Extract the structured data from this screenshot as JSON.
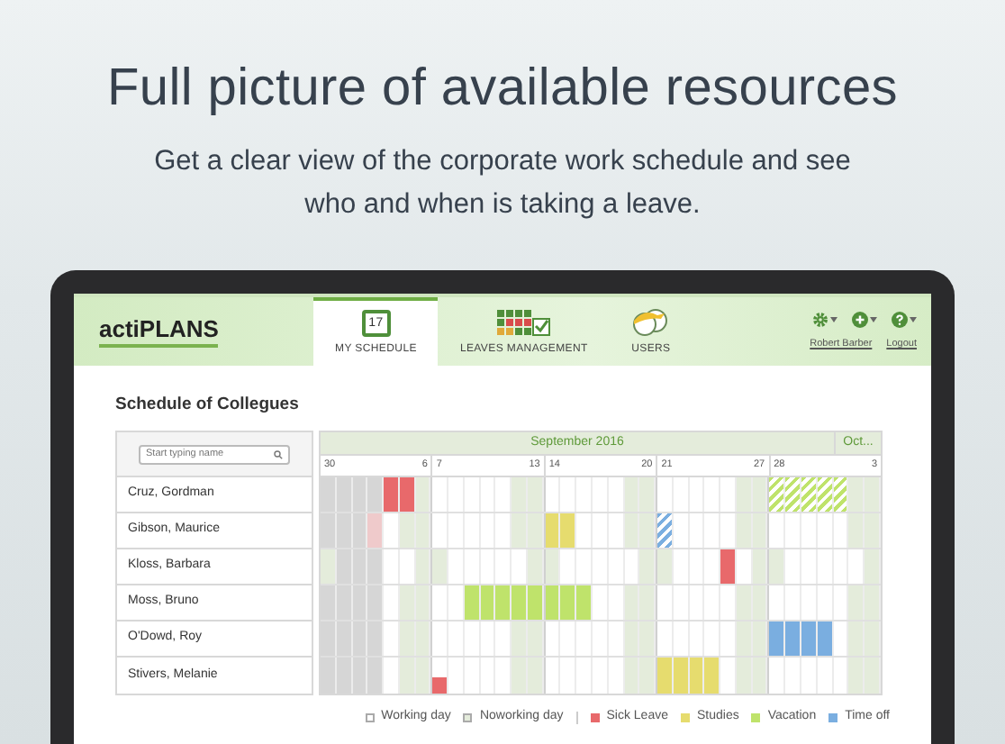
{
  "hero": {
    "title": "Full picture of available resources",
    "subtitle": "Get a clear view of the corporate work schedule and see who and when is taking a leave."
  },
  "app": {
    "logo": "actiPLANS",
    "tabs": [
      {
        "label": "MY SCHEDULE",
        "kind": "calendar",
        "badge": "17",
        "selected": true
      },
      {
        "label": "LEAVES MANAGEMENT",
        "kind": "grid",
        "selected": false
      },
      {
        "label": "USERS",
        "kind": "users",
        "selected": false
      }
    ],
    "tools": [
      {
        "kind": "gear"
      },
      {
        "kind": "plus"
      },
      {
        "kind": "help"
      }
    ],
    "user": "Robert Barber",
    "logout": "Logout"
  },
  "schedule": {
    "title": "Schedule of Collegues",
    "search": {
      "placeholder": "Start typing name"
    },
    "months": [
      "September 2016",
      "Oct..."
    ],
    "weeks": [
      {
        "start": "30",
        "end": "6"
      },
      {
        "start": "7",
        "end": "13"
      },
      {
        "start": "14",
        "end": "20"
      },
      {
        "start": "21",
        "end": "27"
      },
      {
        "start": "28",
        "end": "3"
      }
    ],
    "rows": [
      {
        "name": "Cruz, Gordman",
        "cells": [
          {
            "kind": "past"
          },
          {
            "kind": "past"
          },
          {
            "kind": "past"
          },
          {
            "kind": "past"
          },
          {
            "kind": "sick"
          },
          {
            "kind": "sick"
          },
          {
            "kind": "off"
          },
          {
            "kind": "work"
          },
          {
            "kind": "work"
          },
          {
            "kind": "work"
          },
          {
            "kind": "work"
          },
          {
            "kind": "work"
          },
          {
            "kind": "off"
          },
          {
            "kind": "off"
          },
          {
            "kind": "work"
          },
          {
            "kind": "work"
          },
          {
            "kind": "work"
          },
          {
            "kind": "work"
          },
          {
            "kind": "work"
          },
          {
            "kind": "off"
          },
          {
            "kind": "off"
          },
          {
            "kind": "work"
          },
          {
            "kind": "work"
          },
          {
            "kind": "work"
          },
          {
            "kind": "work"
          },
          {
            "kind": "work"
          },
          {
            "kind": "off"
          },
          {
            "kind": "off"
          },
          {
            "kind": "vacation-req"
          },
          {
            "kind": "vacation-req"
          },
          {
            "kind": "vacation-req"
          },
          {
            "kind": "vacation-req"
          },
          {
            "kind": "vacation-req"
          },
          {
            "kind": "off"
          },
          {
            "kind": "off"
          }
        ]
      },
      {
        "name": "Gibson, Maurice",
        "cells": [
          {
            "kind": "past"
          },
          {
            "kind": "past"
          },
          {
            "kind": "past"
          },
          {
            "kind": "sick-light"
          },
          {
            "kind": "work"
          },
          {
            "kind": "off"
          },
          {
            "kind": "off"
          },
          {
            "kind": "work"
          },
          {
            "kind": "work"
          },
          {
            "kind": "work"
          },
          {
            "kind": "work"
          },
          {
            "kind": "work"
          },
          {
            "kind": "off"
          },
          {
            "kind": "off"
          },
          {
            "kind": "study"
          },
          {
            "kind": "study"
          },
          {
            "kind": "work"
          },
          {
            "kind": "work"
          },
          {
            "kind": "work"
          },
          {
            "kind": "off"
          },
          {
            "kind": "off"
          },
          {
            "kind": "timeoff-req"
          },
          {
            "kind": "work"
          },
          {
            "kind": "work"
          },
          {
            "kind": "work"
          },
          {
            "kind": "work"
          },
          {
            "kind": "off"
          },
          {
            "kind": "off"
          },
          {
            "kind": "work"
          },
          {
            "kind": "work"
          },
          {
            "kind": "work"
          },
          {
            "kind": "work"
          },
          {
            "kind": "work"
          },
          {
            "kind": "off"
          },
          {
            "kind": "off"
          }
        ]
      },
      {
        "name": "Kloss, Barbara",
        "cells": [
          {
            "kind": "off"
          },
          {
            "kind": "past"
          },
          {
            "kind": "past"
          },
          {
            "kind": "past"
          },
          {
            "kind": "work"
          },
          {
            "kind": "work"
          },
          {
            "kind": "off"
          },
          {
            "kind": "off"
          },
          {
            "kind": "work"
          },
          {
            "kind": "work"
          },
          {
            "kind": "work"
          },
          {
            "kind": "work"
          },
          {
            "kind": "work"
          },
          {
            "kind": "off"
          },
          {
            "kind": "off"
          },
          {
            "kind": "work"
          },
          {
            "kind": "work"
          },
          {
            "kind": "work"
          },
          {
            "kind": "work"
          },
          {
            "kind": "work"
          },
          {
            "kind": "off"
          },
          {
            "kind": "off"
          },
          {
            "kind": "work"
          },
          {
            "kind": "work"
          },
          {
            "kind": "work"
          },
          {
            "kind": "sick"
          },
          {
            "kind": "work"
          },
          {
            "kind": "off"
          },
          {
            "kind": "off"
          },
          {
            "kind": "work"
          },
          {
            "kind": "work"
          },
          {
            "kind": "work"
          },
          {
            "kind": "work"
          },
          {
            "kind": "work"
          },
          {
            "kind": "off"
          }
        ]
      },
      {
        "name": "Moss, Bruno",
        "cells": [
          {
            "kind": "past"
          },
          {
            "kind": "past"
          },
          {
            "kind": "past"
          },
          {
            "kind": "past"
          },
          {
            "kind": "work"
          },
          {
            "kind": "off"
          },
          {
            "kind": "off"
          },
          {
            "kind": "work"
          },
          {
            "kind": "work"
          },
          {
            "kind": "vacation"
          },
          {
            "kind": "vacation"
          },
          {
            "kind": "vacation"
          },
          {
            "kind": "vacation"
          },
          {
            "kind": "vacation"
          },
          {
            "kind": "vacation"
          },
          {
            "kind": "vacation"
          },
          {
            "kind": "vacation"
          },
          {
            "kind": "work"
          },
          {
            "kind": "work"
          },
          {
            "kind": "off"
          },
          {
            "kind": "off"
          },
          {
            "kind": "work"
          },
          {
            "kind": "work"
          },
          {
            "kind": "work"
          },
          {
            "kind": "work"
          },
          {
            "kind": "work"
          },
          {
            "kind": "off"
          },
          {
            "kind": "off"
          },
          {
            "kind": "work"
          },
          {
            "kind": "work"
          },
          {
            "kind": "work"
          },
          {
            "kind": "work"
          },
          {
            "kind": "work"
          },
          {
            "kind": "off"
          },
          {
            "kind": "off"
          }
        ]
      },
      {
        "name": "O'Dowd, Roy",
        "cells": [
          {
            "kind": "past"
          },
          {
            "kind": "past"
          },
          {
            "kind": "past"
          },
          {
            "kind": "past"
          },
          {
            "kind": "work"
          },
          {
            "kind": "off"
          },
          {
            "kind": "off"
          },
          {
            "kind": "work"
          },
          {
            "kind": "work"
          },
          {
            "kind": "work"
          },
          {
            "kind": "work"
          },
          {
            "kind": "work"
          },
          {
            "kind": "off"
          },
          {
            "kind": "off"
          },
          {
            "kind": "work"
          },
          {
            "kind": "work"
          },
          {
            "kind": "work"
          },
          {
            "kind": "work"
          },
          {
            "kind": "work"
          },
          {
            "kind": "off"
          },
          {
            "kind": "off"
          },
          {
            "kind": "work"
          },
          {
            "kind": "work"
          },
          {
            "kind": "work"
          },
          {
            "kind": "work"
          },
          {
            "kind": "work"
          },
          {
            "kind": "off"
          },
          {
            "kind": "off"
          },
          {
            "kind": "timeoff"
          },
          {
            "kind": "timeoff"
          },
          {
            "kind": "timeoff"
          },
          {
            "kind": "timeoff"
          },
          {
            "kind": "work"
          },
          {
            "kind": "off"
          },
          {
            "kind": "off"
          }
        ]
      },
      {
        "name": "Stivers, Melanie",
        "cells": [
          {
            "kind": "past"
          },
          {
            "kind": "past"
          },
          {
            "kind": "past"
          },
          {
            "kind": "past"
          },
          {
            "kind": "work"
          },
          {
            "kind": "off"
          },
          {
            "kind": "off"
          },
          {
            "kind": "sick-part"
          },
          {
            "kind": "work"
          },
          {
            "kind": "work"
          },
          {
            "kind": "work"
          },
          {
            "kind": "work"
          },
          {
            "kind": "off"
          },
          {
            "kind": "off"
          },
          {
            "kind": "work"
          },
          {
            "kind": "work"
          },
          {
            "kind": "work"
          },
          {
            "kind": "work"
          },
          {
            "kind": "work"
          },
          {
            "kind": "off"
          },
          {
            "kind": "off"
          },
          {
            "kind": "study"
          },
          {
            "kind": "study"
          },
          {
            "kind": "study"
          },
          {
            "kind": "study"
          },
          {
            "kind": "work"
          },
          {
            "kind": "off"
          },
          {
            "kind": "off"
          },
          {
            "kind": "work"
          },
          {
            "kind": "work"
          },
          {
            "kind": "work"
          },
          {
            "kind": "work"
          },
          {
            "kind": "work"
          },
          {
            "kind": "off"
          },
          {
            "kind": "off"
          }
        ]
      }
    ]
  },
  "legend": [
    {
      "kind": "work",
      "label": "Working day"
    },
    {
      "kind": "off",
      "label": "Noworking day"
    },
    {
      "kind": "divider"
    },
    {
      "kind": "sick",
      "label": "Sick Leave"
    },
    {
      "kind": "study",
      "label": "Studies"
    },
    {
      "kind": "vacation",
      "label": "Vacation"
    },
    {
      "kind": "timeoff",
      "label": "Time off"
    }
  ]
}
